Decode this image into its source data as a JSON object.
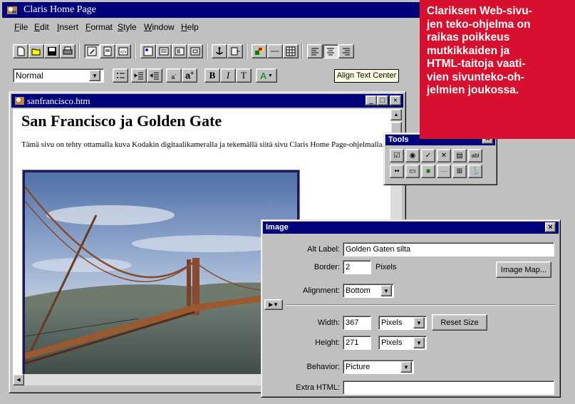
{
  "app": {
    "title": "Claris Home Page"
  },
  "menu": [
    "File",
    "Edit",
    "Insert",
    "Format",
    "Style",
    "Window",
    "Help"
  ],
  "format_toolbar": {
    "style_value": "Normal",
    "tooltip": "Align Text Center",
    "bold": "B",
    "italic": "I",
    "plain": "T",
    "color": "A"
  },
  "document": {
    "window_title": "sanfrancisco.htm",
    "heading": "San Francisco ja Golden Gate",
    "paragraph": "Tämä sivu on tehty ottamalla kuva Kodakin digitaalikameralla ja tekemällä siitä sivu Claris Home Page-ohjelmalla."
  },
  "tools_palette": {
    "title": "Tools"
  },
  "image_dialog": {
    "title": "Image",
    "alt_label": "Alt Label:",
    "alt_value": "Golden Gaten silta",
    "border_label": "Border:",
    "border_value": "2",
    "border_unit": "Pixels",
    "image_map_button": "Image Map...",
    "alignment_label": "Alignment:",
    "alignment_value": "Bottom",
    "width_label": "Width:",
    "width_value": "367",
    "width_unit": "Pixels",
    "reset_size_button": "Reset Size",
    "height_label": "Height:",
    "height_value": "271",
    "height_unit": "Pixels",
    "behavior_label": "Behavior:",
    "behavior_value": "Picture",
    "extra_html_label": "Extra HTML:",
    "extra_html_value": ""
  },
  "caption": "Clariksen Web-sivu-\njen teko-ohjelma on\nraikas poikkeus\nmutkikkaiden ja\nHTML-taitoja vaati-\nvien sivunteko-oh-\njelmien joukossa.",
  "colors": {
    "titlebar": "#00007b",
    "caption_bg": "#d6102e",
    "face": "#c0c0c0"
  }
}
